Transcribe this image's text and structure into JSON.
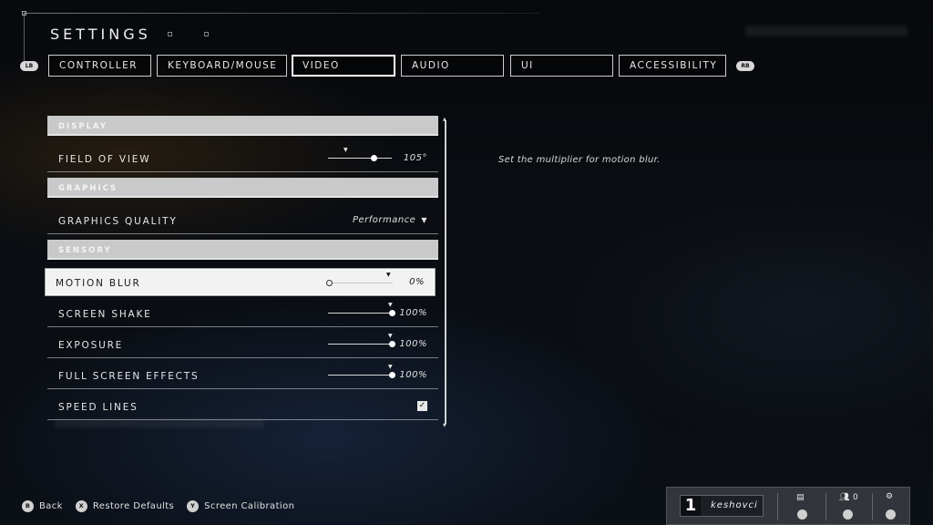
{
  "header": {
    "title": "SETTINGS"
  },
  "tabs": {
    "left_bumper": "LB",
    "right_bumper": "RB",
    "items": [
      {
        "label": "CONTROLLER",
        "active": false
      },
      {
        "label": "KEYBOARD/MOUSE",
        "active": false
      },
      {
        "label": "VIDEO",
        "active": true
      },
      {
        "label": "AUDIO",
        "active": false
      },
      {
        "label": "UI",
        "active": false
      },
      {
        "label": "ACCESSIBILITY",
        "active": false
      }
    ]
  },
  "settings": {
    "display_section": "DISPLAY",
    "field_of_view": {
      "label": "FIELD OF VIEW",
      "value": "105°",
      "level": 0.72
    },
    "graphics_section": "GRAPHICS",
    "graphics_quality": {
      "label": "GRAPHICS QUALITY",
      "value": "Performance"
    },
    "sensory_section": "SENSORY",
    "motion_blur": {
      "label": "MOTION BLUR",
      "value": "0%",
      "level": 0.0,
      "selected": true
    },
    "screen_shake": {
      "label": "SCREEN SHAKE",
      "value": "100%",
      "level": 1.0
    },
    "exposure": {
      "label": "EXPOSURE",
      "value": "100%",
      "level": 1.0
    },
    "full_screen_effects": {
      "label": "FULL SCREEN EFFECTS",
      "value": "100%",
      "level": 1.0
    },
    "speed_lines": {
      "label": "SPEED LINES",
      "checked": true
    }
  },
  "description": "Set the multiplier for motion blur.",
  "footer": {
    "hints": [
      {
        "button": "B",
        "label": "Back"
      },
      {
        "button": "X",
        "label": "Restore Defaults"
      },
      {
        "button": "Y",
        "label": "Screen Calibration"
      }
    ]
  },
  "player": {
    "rank": "1",
    "gamertag": "keshovci",
    "friends_count": "0"
  },
  "colors": {
    "section_bg": "#c9c9c9",
    "selected_row_bg": "#f2f2f2",
    "border": "#ffffff"
  },
  "icons": {
    "check": "check-icon",
    "chat": "chat-icon",
    "friends": "friends-icon",
    "settings": "gear-icon"
  }
}
